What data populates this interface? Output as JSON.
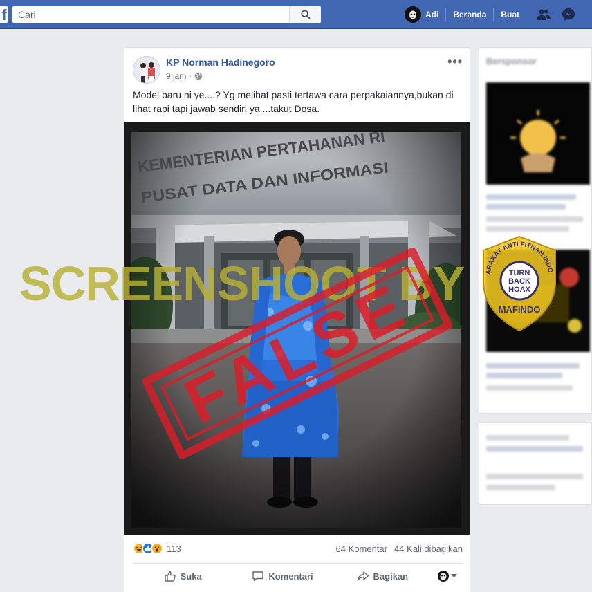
{
  "topbar": {
    "logo_letter": "f",
    "search_placeholder": "Cari",
    "user_name": "Adi",
    "home_label": "Beranda",
    "create_label": "Buat"
  },
  "post": {
    "author": "KP Norman Hadinegoro",
    "time": "9 jam",
    "more_label": "•••",
    "text": "Model baru ni ye....? Yg melihat pasti tertawa cara perpakaiannya,bukan di lihat rapi tapi jawab sendiri ya....takut Dosa.",
    "photo_sign_line1": "KEMENTERIAN PERTAHANAN RI",
    "photo_sign_line2": "PUSAT DATA DAN INFORMASI",
    "reactions": [
      "haha",
      "like",
      "wow"
    ],
    "reaction_count": "113",
    "comments": "64 Komentar",
    "shares": "44 Kali dibagikan",
    "actions": {
      "like": "Suka",
      "comment": "Komentari",
      "share": "Bagikan"
    }
  },
  "overlay": {
    "watermark": "SCREENSHOOT BY",
    "stamp": "FALSE",
    "badge_top": "MASYARAKAT ANTI FITNAH INDONESIA",
    "badge_center1": "TURN",
    "badge_center2": "BACK",
    "badge_center3": "HOAX",
    "badge_bottom": "MAFINDO"
  },
  "sidebar": {
    "title": "Bersponsor"
  },
  "colors": {
    "brand": "#4267b2",
    "link": "#365899",
    "stamp": "#dc1c28",
    "watermark": "#b8b034"
  }
}
